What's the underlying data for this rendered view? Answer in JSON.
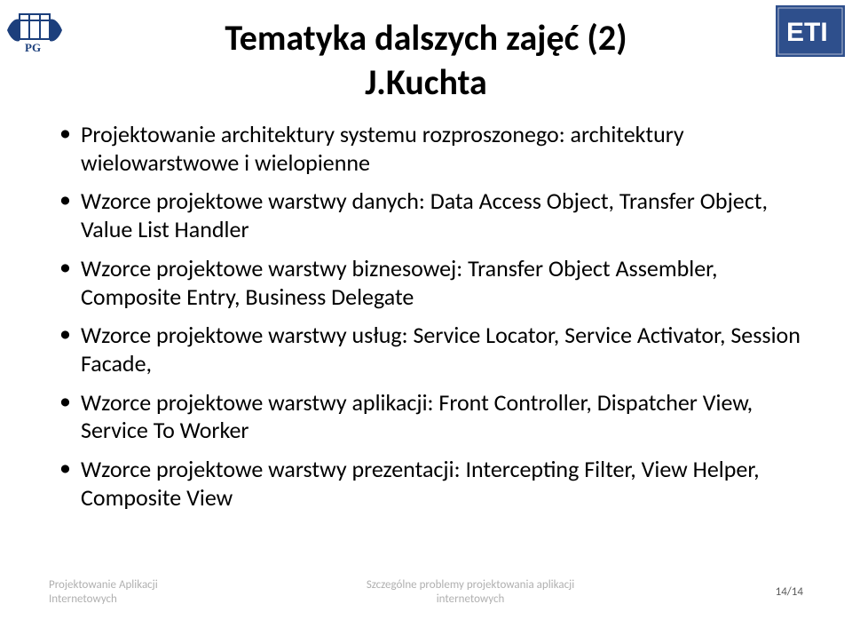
{
  "title_line1": "Tematyka dalszych zajęć (2)",
  "title_line2": "J.Kuchta",
  "bullets": [
    "Projektowanie architektury systemu rozproszonego: architektury wielowarstwowe i wielopienne",
    "Wzorce projektowe warstwy danych: Data Access Object, Transfer Object, Value List Handler",
    "Wzorce projektowe warstwy biznesowej: Transfer Object Assembler, Composite Entry, Business Delegate",
    "Wzorce projektowe warstwy usług: Service Locator, Service Activator, Session Facade,",
    "Wzorce projektowe warstwy aplikacji: Front Controller, Dispatcher View, Service To Worker",
    "Wzorce projektowe warstwy prezentacji: Intercepting Filter, View Helper, Composite View"
  ],
  "footer": {
    "left_l1": "Projektowanie Aplikacji",
    "left_l2": "Internetowych",
    "center_l1": "Szczególne problemy projektowania aplikacji",
    "center_l2": "internetowych",
    "page": "14/14"
  }
}
